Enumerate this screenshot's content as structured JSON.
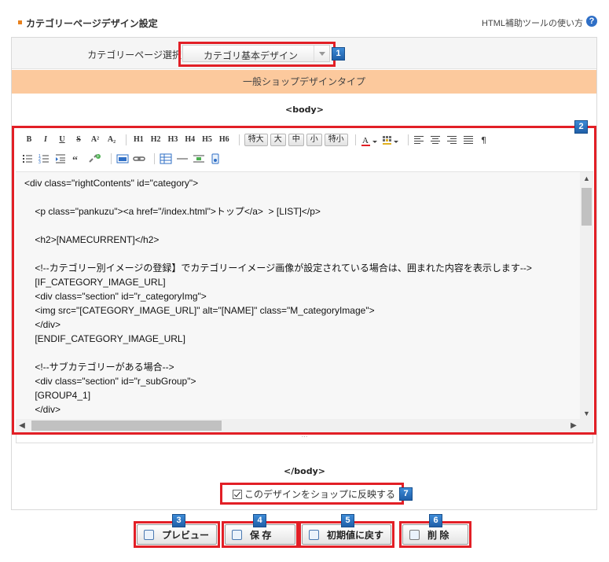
{
  "header": {
    "title": "カテゴリーページデザイン設定",
    "help_link": "HTML補助ツールの使い方",
    "help_icon": "?"
  },
  "category_select": {
    "label": "カテゴリーページ選択",
    "selected": "カテゴリ基本デザイン"
  },
  "design_type": "一般ショップデザインタイプ",
  "body_open": "<body>",
  "body_close": "</body>",
  "toolbar": {
    "row1": [
      "B",
      "I",
      "U",
      "S",
      "A²",
      "A₂",
      "H1",
      "H2",
      "H3",
      "H4",
      "H5",
      "H6"
    ],
    "sizes": [
      "特大",
      "大",
      "中",
      "小",
      "特小"
    ],
    "align_icons": [
      "align-left-icon",
      "align-center-icon",
      "align-right-icon",
      "align-justify-icon",
      "paragraph-icon"
    ],
    "row2_icons": [
      "bullet-list-icon",
      "numbered-list-icon",
      "indent-icon",
      "quote-icon",
      "unlink-icon",
      "image-icon",
      "link-icon",
      "table-icon",
      "horizontal-rule-icon",
      "insert-row-icon",
      "media-icon"
    ]
  },
  "editor": {
    "code": "<div class=\"rightContents\" id=\"category\">\n\n    <p class=\"pankuzu\"><a href=\"/index.html\">トップ</a>  > [LIST]</p>\n\n    <h2>[NAMECURRENT]</h2>\n\n    <!--カテゴリー別イメージの登録】でカテゴリーイメージ画像が設定されている場合は、囲まれた内容を表示します-->\n    [IF_CATEGORY_IMAGE_URL]\n    <div class=\"section\" id=\"r_categoryImg\">\n    <img src=\"[CATEGORY_IMAGE_URL]\" alt=\"[NAME]\" class=\"M_categoryImage\">\n    </div>\n    [ENDIF_CATEGORY_IMAGE_URL]\n\n    <!--サブカテゴリーがある場合-->\n    <div class=\"section\" id=\"r_subGroup\">\n    [GROUP4_1]\n    </div>"
  },
  "reflect_checkbox": {
    "label": "このデザインをショップに反映する",
    "checked": true
  },
  "buttons": {
    "preview": "プレビュー",
    "save": "保 存",
    "reset": "初期値に戻す",
    "delete": "削 除"
  },
  "badges": [
    "1",
    "2",
    "3",
    "4",
    "5",
    "6",
    "7"
  ],
  "colors": {
    "highlight_red": "#e21f26",
    "badge_blue": "#2f6fc6",
    "type_bar": "#fcc99d",
    "title_bullet": "#e8811d"
  }
}
